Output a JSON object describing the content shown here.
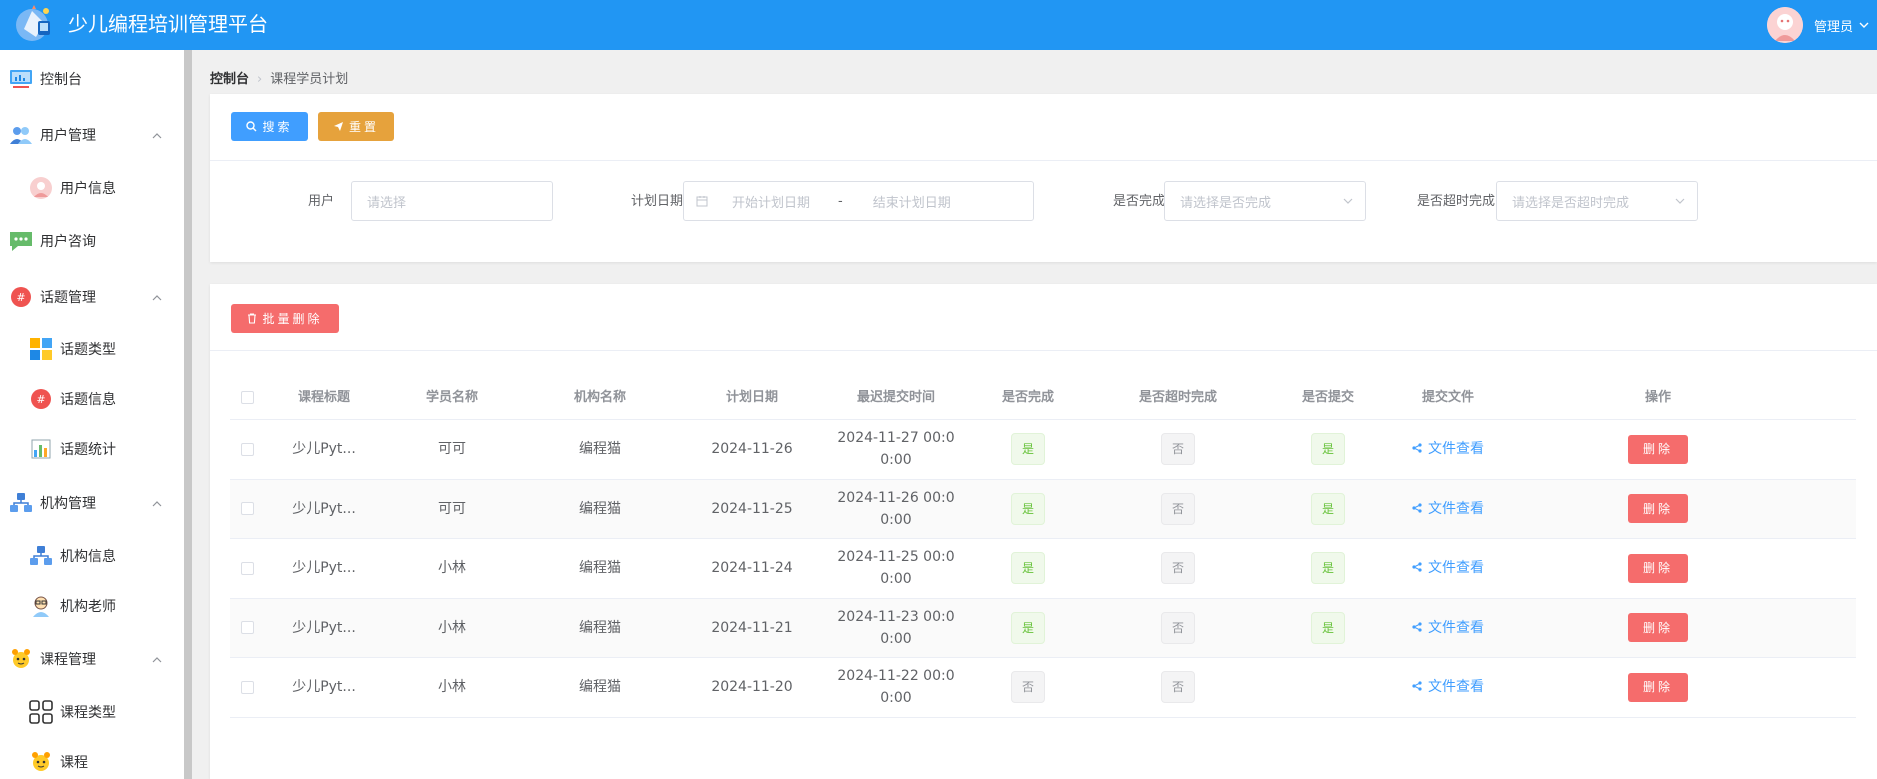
{
  "header": {
    "title": "少儿编程培训管理平台",
    "user_name": "管理员"
  },
  "sidebar": {
    "items": [
      {
        "label": "控制台",
        "icon": "monitor-icon"
      },
      {
        "label": "用户管理",
        "icon": "users-icon"
      },
      {
        "label": "用户信息",
        "icon": "user-avatar-icon"
      },
      {
        "label": "用户咨询",
        "icon": "chat-icon"
      },
      {
        "label": "话题管理",
        "icon": "hashtag-icon"
      },
      {
        "label": "话题类型",
        "icon": "blocks-icon"
      },
      {
        "label": "话题信息",
        "icon": "hashtag-icon"
      },
      {
        "label": "话题统计",
        "icon": "bar-chart-icon"
      },
      {
        "label": "机构管理",
        "icon": "org-tree-icon"
      },
      {
        "label": "机构信息",
        "icon": "org-tree-icon"
      },
      {
        "label": "机构老师",
        "icon": "teacher-icon"
      },
      {
        "label": "课程管理",
        "icon": "mascot-icon"
      },
      {
        "label": "课程类型",
        "icon": "grid-icon"
      },
      {
        "label": "课程",
        "icon": "mascot-icon"
      }
    ]
  },
  "breadcrumb": {
    "home": "控制台",
    "current": "课程学员计划"
  },
  "search": {
    "search_label": "搜索",
    "reset_label": "重置",
    "user_label": "用户",
    "user_placeholder": "请选择",
    "date_label": "计划日期",
    "date_start_placeholder": "开始计划日期",
    "date_sep": "-",
    "date_end_placeholder": "结束计划日期",
    "done_label": "是否完成",
    "done_placeholder": "请选择是否完成",
    "overtime_label": "是否超时完成",
    "overtime_placeholder": "请选择是否超时完成"
  },
  "toolbar": {
    "batch_delete_label": "批量删除"
  },
  "table": {
    "columns": [
      "课程标题",
      "学员名称",
      "机构名称",
      "计划日期",
      "最迟提交时间",
      "是否完成",
      "是否超时完成",
      "是否提交",
      "提交文件",
      "操作"
    ],
    "rows": [
      {
        "title": "少儿Pyt...",
        "student": "可可",
        "org": "编程猫",
        "date": "2024-11-26",
        "deadline_1": "2024-11-27 00:0",
        "deadline_2": "0:00",
        "done": "是",
        "overtime": "否",
        "submitted": "是",
        "file": "文件查看",
        "action": "删除"
      },
      {
        "title": "少儿Pyt...",
        "student": "可可",
        "org": "编程猫",
        "date": "2024-11-25",
        "deadline_1": "2024-11-26 00:0",
        "deadline_2": "0:00",
        "done": "是",
        "overtime": "否",
        "submitted": "是",
        "file": "文件查看",
        "action": "删除"
      },
      {
        "title": "少儿Pyt...",
        "student": "小林",
        "org": "编程猫",
        "date": "2024-11-24",
        "deadline_1": "2024-11-25 00:0",
        "deadline_2": "0:00",
        "done": "是",
        "overtime": "否",
        "submitted": "是",
        "file": "文件查看",
        "action": "删除"
      },
      {
        "title": "少儿Pyt...",
        "student": "小林",
        "org": "编程猫",
        "date": "2024-11-21",
        "deadline_1": "2024-11-23 00:0",
        "deadline_2": "0:00",
        "done": "是",
        "overtime": "否",
        "submitted": "是",
        "file": "文件查看",
        "action": "删除"
      },
      {
        "title": "少儿Pyt...",
        "student": "小林",
        "org": "编程猫",
        "date": "2024-11-20",
        "deadline_1": "2024-11-22 00:0",
        "deadline_2": "0:00",
        "done": "否",
        "overtime": "否",
        "submitted": "",
        "file": "文件查看",
        "action": "删除"
      }
    ]
  },
  "colors": {
    "header_bg": "#2196f3",
    "primary": "#409eff",
    "warning": "#e6a23c",
    "danger": "#f56c6c",
    "success": "#67c23a"
  }
}
